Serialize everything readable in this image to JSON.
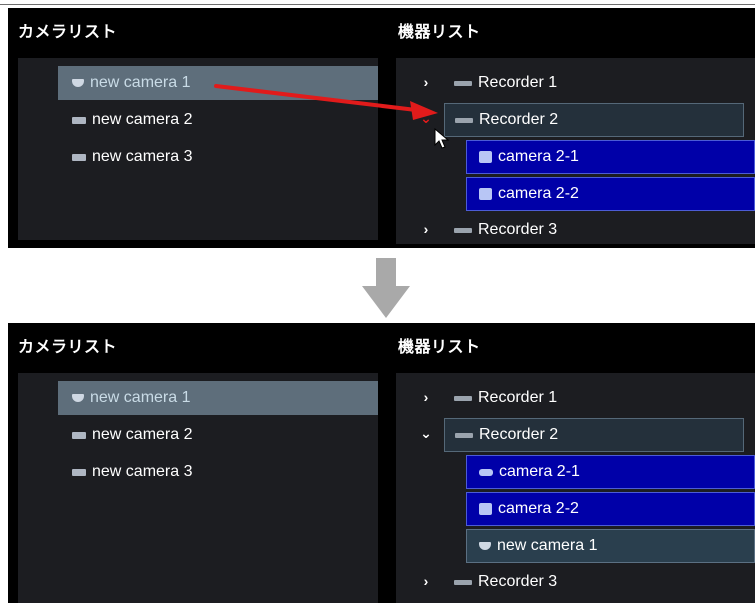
{
  "before": {
    "camera_list_title": "カメラリスト",
    "device_list_title": "機器リスト",
    "cameras": [
      {
        "label": "new camera 1",
        "icon": "dome-camera-icon",
        "selected": true
      },
      {
        "label": "new camera 2",
        "icon": "box-camera-icon",
        "selected": false
      },
      {
        "label": "new camera 3",
        "icon": "box-camera-icon",
        "selected": false
      }
    ],
    "recorders": [
      {
        "label": "Recorder 1",
        "chevron": "›",
        "expanded": false
      },
      {
        "label": "Recorder 2",
        "chevron": "⌄",
        "expanded": true,
        "children": [
          {
            "label": "camera 2-1",
            "icon": "ptz-camera-icon"
          },
          {
            "label": "camera 2-2",
            "icon": "ptz-camera-icon"
          }
        ]
      },
      {
        "label": "Recorder 3",
        "chevron": "›",
        "expanded": false
      }
    ]
  },
  "after": {
    "camera_list_title": "カメラリスト",
    "device_list_title": "機器リスト",
    "cameras": [
      {
        "label": "new camera 1",
        "icon": "dome-camera-icon",
        "selected": true
      },
      {
        "label": "new camera 2",
        "icon": "box-camera-icon",
        "selected": false
      },
      {
        "label": "new camera 3",
        "icon": "box-camera-icon",
        "selected": false
      }
    ],
    "recorders": [
      {
        "label": "Recorder 1",
        "chevron": "›",
        "expanded": false
      },
      {
        "label": "Recorder 2",
        "chevron": "⌄",
        "expanded": true,
        "children": [
          {
            "label": "camera 2-1",
            "icon": "bullet-camera-icon"
          },
          {
            "label": "camera 2-2",
            "icon": "ptz-camera-icon"
          },
          {
            "label": "new camera 1",
            "icon": "dome-camera-icon"
          }
        ]
      },
      {
        "label": "Recorder 3",
        "chevron": "›",
        "expanded": false
      }
    ]
  },
  "colors": {
    "panel_bg": "#000000",
    "list_bg": "#1c1d21",
    "selected_camera_bg": "#5e6e7b",
    "child_row_bg": "#0000a8",
    "added_row_bg": "#2a3f4e",
    "drag_arrow": "#e11b1b",
    "transition_arrow": "#a9a9a9"
  }
}
